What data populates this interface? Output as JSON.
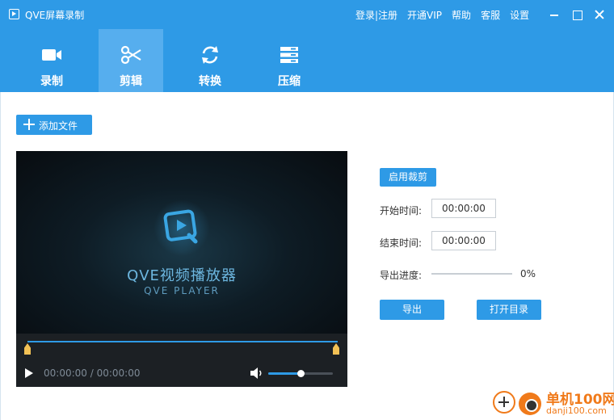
{
  "app": {
    "title": "QVE屏幕录制",
    "accent": "#2e9ae6",
    "icon": "app-play-icon"
  },
  "top_links": [
    "登录|注册",
    "开通VIP",
    "帮助",
    "客服",
    "设置"
  ],
  "window_controls": [
    "minimize-icon",
    "maximize-icon",
    "close-icon"
  ],
  "tabs": [
    {
      "label": "录制",
      "icon": "video-camera-icon",
      "active": false
    },
    {
      "label": "剪辑",
      "icon": "scissors-icon",
      "active": true
    },
    {
      "label": "转换",
      "icon": "refresh-icon",
      "active": false
    },
    {
      "label": "压缩",
      "icon": "compress-icon",
      "active": false
    }
  ],
  "toolbar": {
    "add_file_label": "添加文件"
  },
  "player": {
    "brand_cn": "QVE视频播放器",
    "brand_en": "QVE PLAYER",
    "time_display": "00:00:00 / 00:00:00",
    "volume": 0.5
  },
  "crop_panel": {
    "enable_crop_label": "启用裁剪",
    "start_time_label": "开始时间:",
    "start_time_value": "00:00:00",
    "end_time_label": "结束时间:",
    "end_time_value": "00:00:00",
    "progress_label": "导出进度:",
    "progress_value": 0,
    "progress_text": "0%",
    "export_label": "导出",
    "open_dir_label": "打开目录"
  },
  "watermark": {
    "text": "单机100网",
    "url": "danji100.com"
  }
}
